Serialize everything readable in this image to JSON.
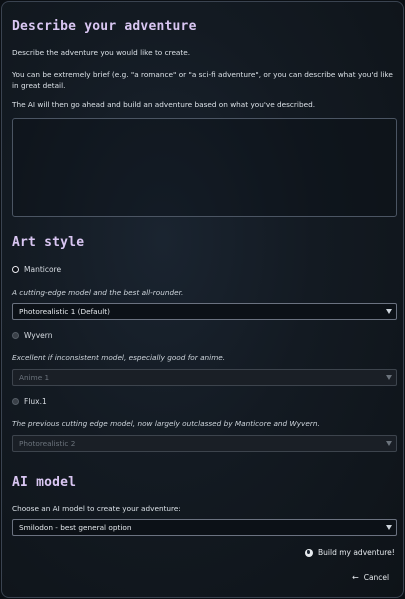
{
  "describe": {
    "heading": "Describe your adventure",
    "p1": "Describe the adventure you would like to create.",
    "p2": "You can be extremely brief (e.g. \"a romance\" or \"a sci-fi adventure\", or you can describe what you'd like in great detail.",
    "p3": "The AI will then go ahead and build an adventure based on what you've described.",
    "textarea_value": ""
  },
  "art_style": {
    "heading": "Art style",
    "options": [
      {
        "label": "Manticore",
        "selected": true,
        "description": "A cutting-edge model and the best all-rounder.",
        "select_value": "Photorealistic 1 (Default)",
        "enabled": true
      },
      {
        "label": "Wyvern",
        "selected": false,
        "description": "Excellent if inconsistent model, especially good for anime.",
        "select_value": "Anime 1",
        "enabled": false
      },
      {
        "label": "Flux.1",
        "selected": false,
        "description": "The previous cutting edge model, now largely outclassed by Manticore and Wyvern.",
        "select_value": "Photorealistic 2",
        "enabled": false
      }
    ]
  },
  "ai_model": {
    "heading": "AI model",
    "prompt": "Choose an AI model to create your adventure:",
    "select_value": "Smilodon - best general option"
  },
  "actions": {
    "build_label": "Build my adventure!",
    "build_icon": "globe-icon",
    "cancel_label": "Cancel",
    "cancel_icon": "arrow-left-icon"
  },
  "colors": {
    "heading": "#d9c6f2",
    "background": "#131a22"
  }
}
